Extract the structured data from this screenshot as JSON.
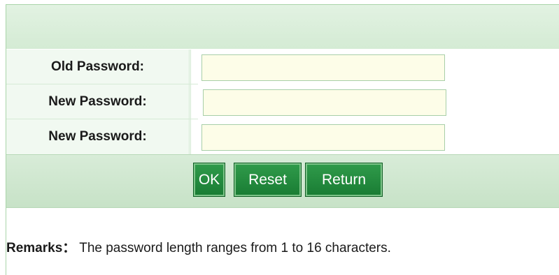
{
  "form": {
    "old_password_label": "Old Password:",
    "new_password_label": "New Password:",
    "confirm_password_label": "New Password:",
    "old_password_value": "",
    "new_password_value": "",
    "confirm_password_value": ""
  },
  "buttons": {
    "ok": "OK",
    "reset": "Reset",
    "return": "Return"
  },
  "remarks": {
    "label": "Remarks：",
    "text": " The password length ranges from 1 to 16 characters."
  },
  "colors": {
    "accent": "#1a7d34",
    "band": "#d4ebd4",
    "input_bg": "#fdfde8"
  }
}
